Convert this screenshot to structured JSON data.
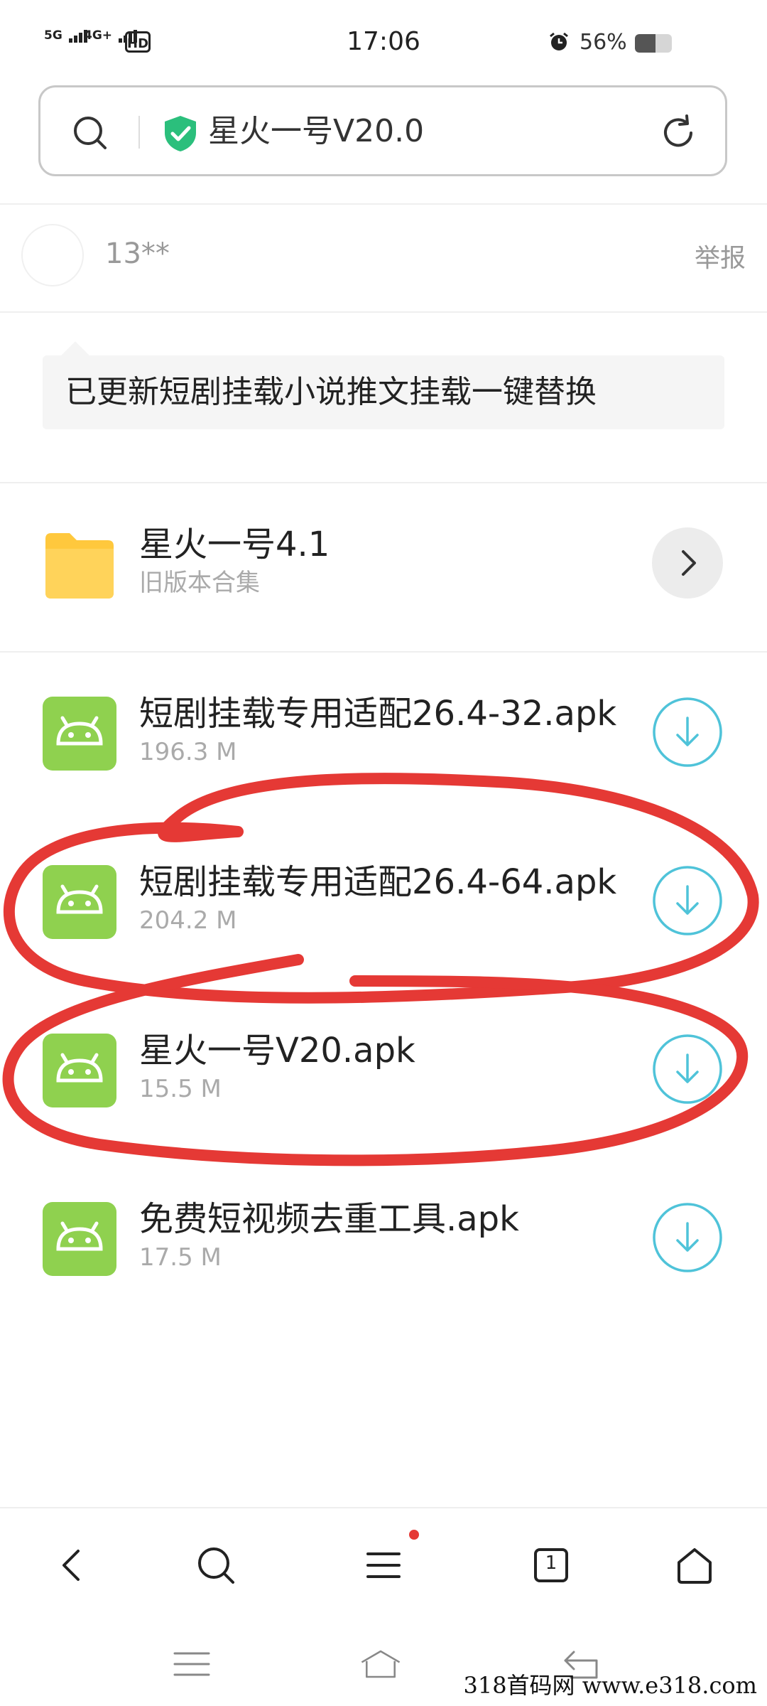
{
  "status_bar": {
    "signal1": "5G",
    "signal2": "4G+",
    "hd": "HD",
    "time": "17:06",
    "battery_percent": "56%",
    "battery_level": 0.56
  },
  "search": {
    "query": "星火一号V20.0"
  },
  "post": {
    "username": "13**",
    "report_label": "举报",
    "note": "已更新短剧挂载小说推文挂载一键替换"
  },
  "files": [
    {
      "name": "星火一号4.1",
      "subtitle": "旧版本合集",
      "type": "folder"
    },
    {
      "name": "短剧挂载专用适配26.4-32.apk",
      "subtitle": "196.3 M",
      "type": "apk"
    },
    {
      "name": "短剧挂载专用适配26.4-64.apk",
      "subtitle": "204.2 M",
      "type": "apk"
    },
    {
      "name": "星火一号V20.apk",
      "subtitle": "15.5 M",
      "type": "apk"
    },
    {
      "name": "免费短视频去重工具.apk",
      "subtitle": "17.5 M",
      "type": "apk"
    }
  ],
  "toolbar": {
    "tab_count": "1"
  },
  "watermark": "318首码网  www.e318.com",
  "colors": {
    "accent_cyan": "#4fc3d9",
    "apk_green": "#8fd14f",
    "folder_yellow": "#ffc83d",
    "shield_green": "#2bbf7c",
    "annotation_red": "#e53935"
  }
}
